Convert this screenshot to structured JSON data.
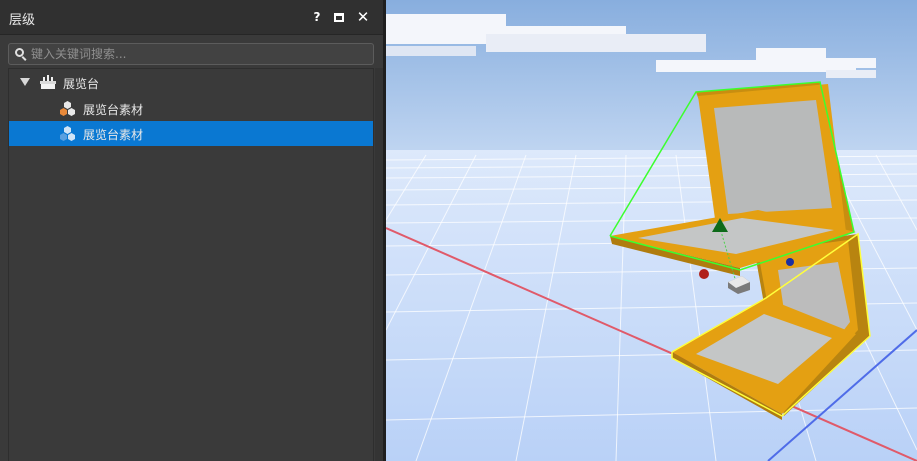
{
  "panel": {
    "title": "层级",
    "help_label": "?",
    "close_label": "✕"
  },
  "search": {
    "placeholder": "键入关键词搜索..."
  },
  "tree": {
    "root": {
      "label": "展览台",
      "expanded": true,
      "icon": "exhibition-stand-icon"
    },
    "children": [
      {
        "label": "展览台素材",
        "selected": false,
        "icon": "material-cluster-icon"
      },
      {
        "label": "展览台素材",
        "selected": true,
        "icon": "material-cluster-icon"
      }
    ]
  },
  "colors": {
    "panel_bg": "#3a3a3a",
    "header_bg": "#303030",
    "selection": "#0a78d2",
    "sky_top": "#8ab2e0",
    "ground": "#c9dcfb",
    "model_frame": "#e4a012",
    "model_inner": "#c4c4c4",
    "outline_selected": "#3cff2e",
    "outline_other": "#ffff3c"
  }
}
